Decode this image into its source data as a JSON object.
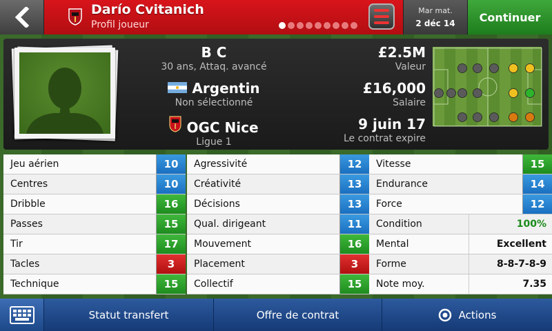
{
  "header": {
    "player_name": "Darío Cvitanich",
    "subtitle": "Profil joueur",
    "date_day": "Mar mat.",
    "date": "2 déc 14",
    "continue_label": "Continuer"
  },
  "profile": {
    "position": "B C",
    "age_role": "30 ans, Attaq. avancé",
    "nationality": "Argentin",
    "selection_status": "Non sélectionné",
    "club": "OGC Nice",
    "league": "Ligue 1",
    "value": "£2.5M",
    "value_label": "Valeur",
    "wage": "£16,000",
    "wage_label": "Salaire",
    "contract_end": "9 juin 17",
    "contract_label": "Le contrat expire"
  },
  "attributes": {
    "col1": [
      {
        "label": "Jeu aérien",
        "value": "10",
        "color": "blue"
      },
      {
        "label": "Centres",
        "value": "10",
        "color": "blue"
      },
      {
        "label": "Dribble",
        "value": "16",
        "color": "green"
      },
      {
        "label": "Passes",
        "value": "15",
        "color": "green"
      },
      {
        "label": "Tir",
        "value": "17",
        "color": "green"
      },
      {
        "label": "Tacles",
        "value": "3",
        "color": "red"
      },
      {
        "label": "Technique",
        "value": "15",
        "color": "green"
      }
    ],
    "col2": [
      {
        "label": "Agressivité",
        "value": "12",
        "color": "blue"
      },
      {
        "label": "Créativité",
        "value": "13",
        "color": "blue"
      },
      {
        "label": "Décisions",
        "value": "13",
        "color": "blue"
      },
      {
        "label": "Qual. dirigeant",
        "value": "11",
        "color": "blue"
      },
      {
        "label": "Mouvement",
        "value": "16",
        "color": "green"
      },
      {
        "label": "Placement",
        "value": "3",
        "color": "red"
      },
      {
        "label": "Collectif",
        "value": "15",
        "color": "green"
      }
    ],
    "col3": [
      {
        "label": "Vitesse",
        "value": "15",
        "color": "green"
      },
      {
        "label": "Endurance",
        "value": "14",
        "color": "blue"
      },
      {
        "label": "Force",
        "value": "12",
        "color": "blue"
      },
      {
        "label": "Condition",
        "value": "100%",
        "color": "text-pct"
      },
      {
        "label": "Mental",
        "value": "Excellent",
        "color": "text"
      },
      {
        "label": "Forme",
        "value": "8-8-7-8-9",
        "color": "text"
      },
      {
        "label": "Note moy.",
        "value": "7.35",
        "color": "text"
      }
    ]
  },
  "bottom": {
    "statut_label": "Statut transfert",
    "offre_label": "Offre de contrat",
    "actions_label": "Actions"
  },
  "colors": {
    "header_red": "#c8111a",
    "continue_green": "#2e9a2e",
    "attr_blue": "#2a84d0",
    "attr_green": "#2ca82a",
    "attr_red": "#cc1f1f"
  },
  "pitch_positions": [
    {
      "color": "grey"
    },
    {
      "color": "grey"
    },
    {
      "color": "grey"
    },
    {
      "color": "yellow"
    },
    {
      "color": "yellow"
    },
    {
      "color": "grey"
    },
    {
      "color": "grey"
    },
    {
      "color": "grey"
    },
    {
      "color": "yellow"
    },
    {
      "color": "green"
    },
    {
      "color": "grey"
    },
    {
      "color": "grey"
    },
    {
      "color": "grey"
    },
    {
      "color": "orange"
    },
    {
      "color": "orange"
    },
    {
      "color": "grey"
    }
  ]
}
